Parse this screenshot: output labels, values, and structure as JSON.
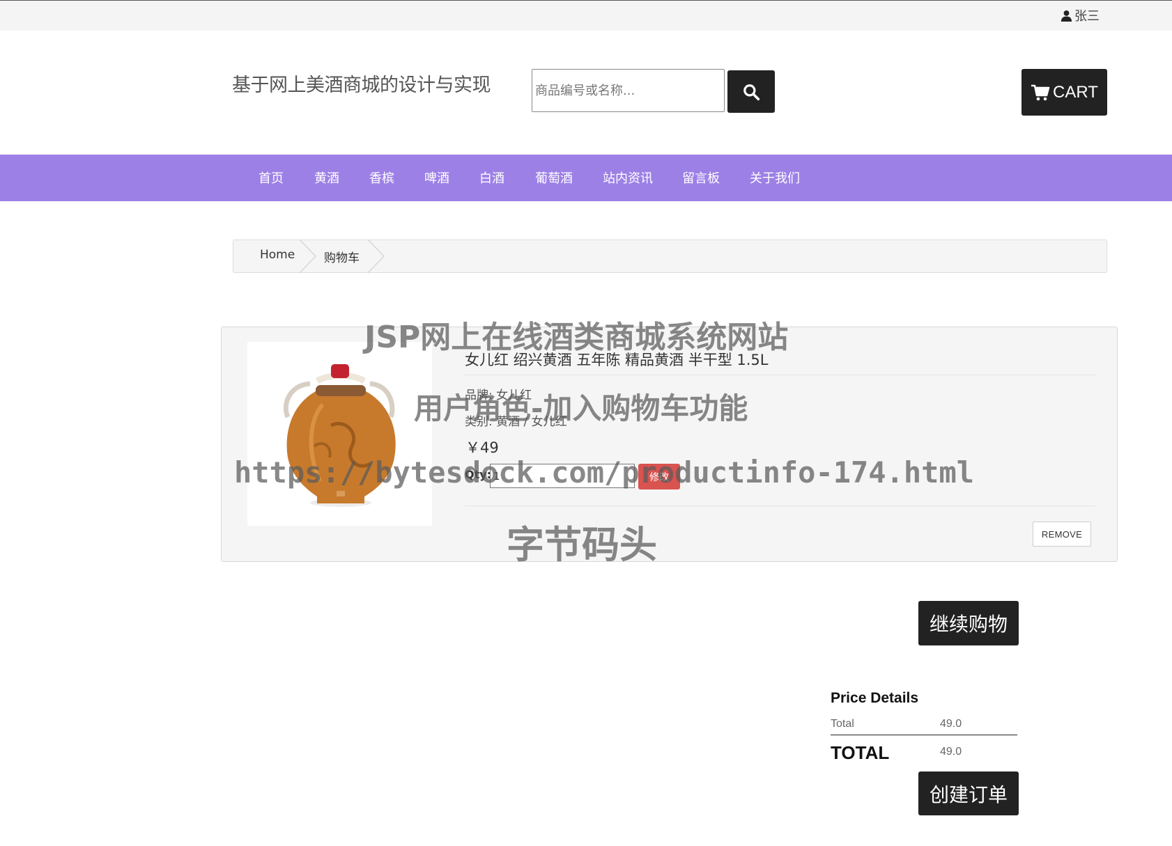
{
  "topbar": {
    "user_name": "张三"
  },
  "header": {
    "site_title": "基于网上美酒商城的设计与实现",
    "search_placeholder": "商品编号或名称...",
    "cart_label": "CART"
  },
  "nav": {
    "items": [
      "首页",
      "黄酒",
      "香槟",
      "啤酒",
      "白酒",
      "葡萄酒",
      "站内资讯",
      "留言板",
      "关于我们"
    ]
  },
  "breadcrumb": {
    "home": "Home",
    "current": "购物车"
  },
  "cart_item": {
    "name": "女儿红 绍兴黄酒 五年陈 精品黄酒 半干型 1.5L",
    "brand": "品牌: 女儿红",
    "category": "类别: 黄酒 / 女儿红",
    "price": "￥49",
    "qty_label": "Qty:",
    "qty_value": "1",
    "modify_label": "修改",
    "remove_label": "REMOVE"
  },
  "actions": {
    "continue_label": "继续购物",
    "create_order_label": "创建订单"
  },
  "price_details": {
    "title": "Price Details",
    "total_label": "Total",
    "total_value": "49.0",
    "grand_label": "TOTAL",
    "grand_value": "49.0"
  },
  "watermark": {
    "line1": "JSP网上在线酒类商城系统网站",
    "line2": "用户角色-加入购物车功能",
    "line3": "https://bytesdock.com/productinfo-174.html",
    "line4": "字节码头"
  },
  "colors": {
    "nav_bg": "#9d80e6",
    "dark_button": "#222222",
    "modify_button": "#d9534f"
  }
}
